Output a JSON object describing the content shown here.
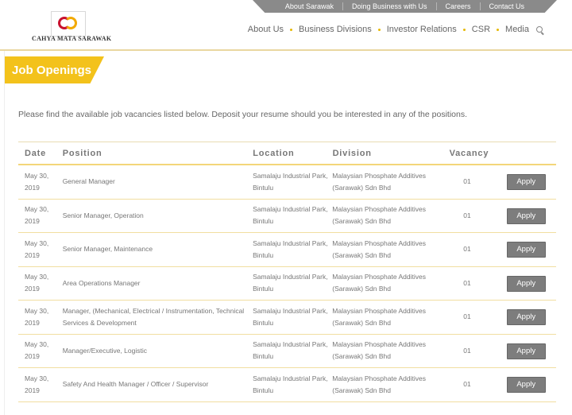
{
  "topbar": {
    "links": [
      "About Sarawak",
      "Doing Business with Us",
      "Careers",
      "Contact Us"
    ]
  },
  "brand": {
    "logo_text": "CAHYA MATA SARAWAK"
  },
  "nav": {
    "items": [
      "About Us",
      "Business Divisions",
      "Investor Relations",
      "CSR",
      "Media"
    ]
  },
  "page": {
    "title": "Job Openings",
    "intro": "Please find the available job vacancies listed below. Deposit your resume should you be interested in any of the positions."
  },
  "table": {
    "headers": {
      "date": "Date",
      "position": "Position",
      "location": "Location",
      "division": "Division",
      "vacancy": "Vacancy"
    },
    "apply_label": "Apply",
    "rows": [
      {
        "date": "May 30, 2019",
        "position": "General Manager",
        "location": "Samalaju Industrial Park, Bintulu",
        "division": "Malaysian Phosphate Additives (Sarawak) Sdn Bhd",
        "vacancy": "01"
      },
      {
        "date": "May 30, 2019",
        "position": "Senior Manager, Operation",
        "location": "Samalaju Industrial Park, Bintulu",
        "division": "Malaysian Phosphate Additives (Sarawak) Sdn Bhd",
        "vacancy": "01"
      },
      {
        "date": "May 30, 2019",
        "position": "Senior Manager, Maintenance",
        "location": "Samalaju Industrial Park, Bintulu",
        "division": "Malaysian Phosphate Additives (Sarawak) Sdn Bhd",
        "vacancy": "01"
      },
      {
        "date": "May 30, 2019",
        "position": "Area Operations Manager",
        "location": "Samalaju Industrial Park, Bintulu",
        "division": "Malaysian Phosphate Additives (Sarawak) Sdn Bhd",
        "vacancy": "01"
      },
      {
        "date": "May 30, 2019",
        "position": "Manager, (Mechanical, Electrical / Instrumentation, Technical Services & Development",
        "location": "Samalaju Industrial Park, Bintulu",
        "division": "Malaysian Phosphate Additives (Sarawak) Sdn Bhd",
        "vacancy": "01"
      },
      {
        "date": "May 30, 2019",
        "position": "Manager/Executive, Logistic",
        "location": "Samalaju Industrial Park, Bintulu",
        "division": "Malaysian Phosphate Additives (Sarawak) Sdn Bhd",
        "vacancy": "01"
      },
      {
        "date": "May 30, 2019",
        "position": "Safety And Health Manager / Officer / Supervisor",
        "location": "Samalaju Industrial Park, Bintulu",
        "division": "Malaysian Phosphate Additives (Sarawak) Sdn Bhd",
        "vacancy": "01"
      }
    ]
  },
  "colors": {
    "accent": "#f3c21b",
    "button": "#7d7d7d",
    "topbar": "#8a8a8a"
  },
  "icons": {
    "search": "search-icon"
  }
}
